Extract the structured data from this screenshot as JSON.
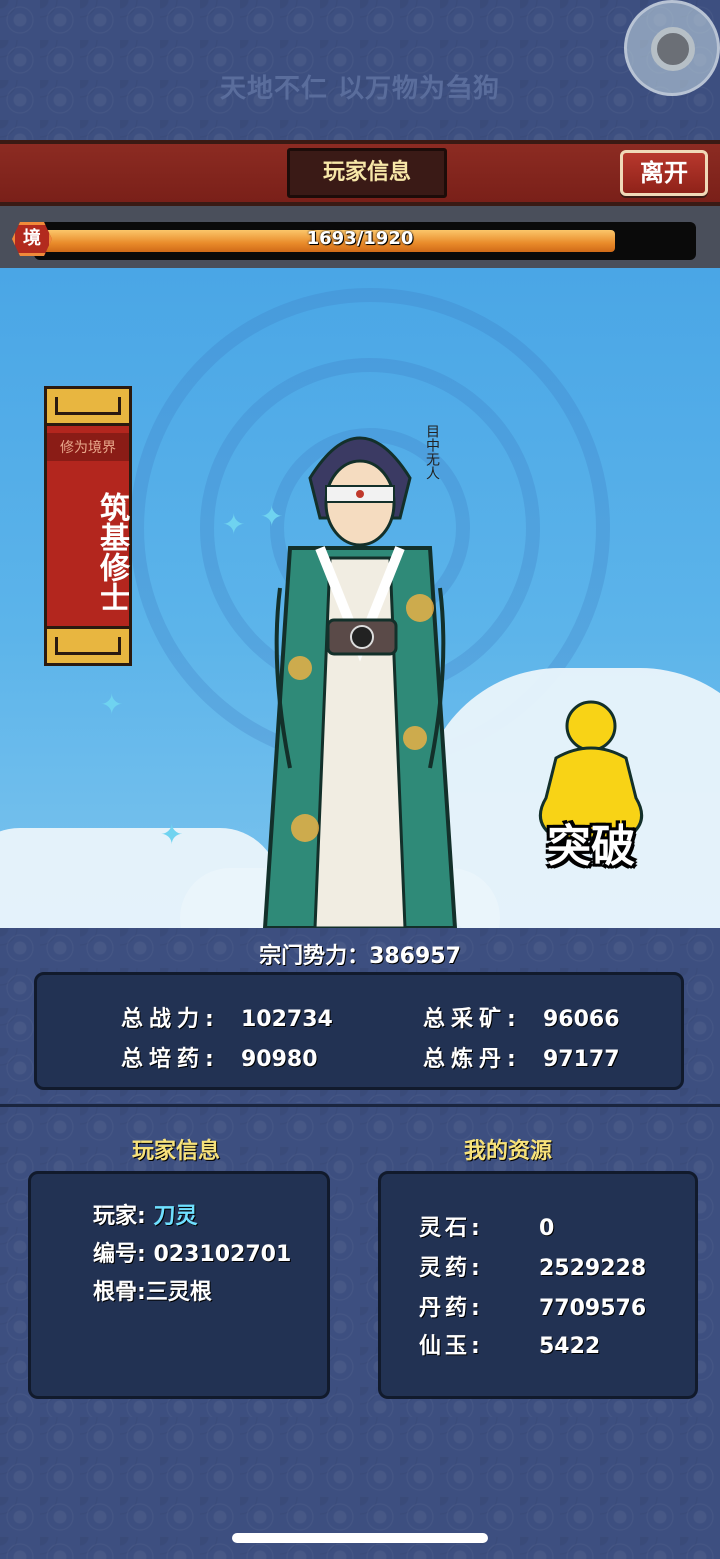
{
  "top": {
    "motto": "天地不仁 以万物为刍狗"
  },
  "header": {
    "title": "玩家信息",
    "leave_label": "离开"
  },
  "progress": {
    "badge": "境",
    "current": 1693,
    "max": 1920,
    "text": "1693/1920"
  },
  "scene": {
    "realm_label": "修为境界",
    "realm_name": "筑基修士",
    "character_tag": "目中无人",
    "breakthrough_label": "突破"
  },
  "sect": {
    "title": "宗门势力：386957",
    "stats": [
      {
        "label": "总战力:",
        "value": "102734"
      },
      {
        "label": "总采矿:",
        "value": "96066"
      },
      {
        "label": "总培药:",
        "value": "90980"
      },
      {
        "label": "总炼丹:",
        "value": "97177"
      }
    ]
  },
  "player_info": {
    "title": "玩家信息",
    "rows": [
      {
        "label": "玩家:",
        "value": "刀灵"
      },
      {
        "label": "编号:",
        "value": "023102701"
      },
      {
        "label": "根骨:",
        "value": "三灵根"
      }
    ]
  },
  "resources": {
    "title": "我的资源",
    "rows": [
      {
        "label": "灵石:",
        "value": "0"
      },
      {
        "label": "灵药:",
        "value": "2529228"
      },
      {
        "label": "丹药:",
        "value": "7709576"
      },
      {
        "label": "仙玉:",
        "value": "5422"
      }
    ]
  },
  "colors": {
    "header_red": "#8c2b22",
    "accent_gold": "#f7e27a",
    "panel_bg": "#223253",
    "exp_fill": "#e98b2a"
  }
}
